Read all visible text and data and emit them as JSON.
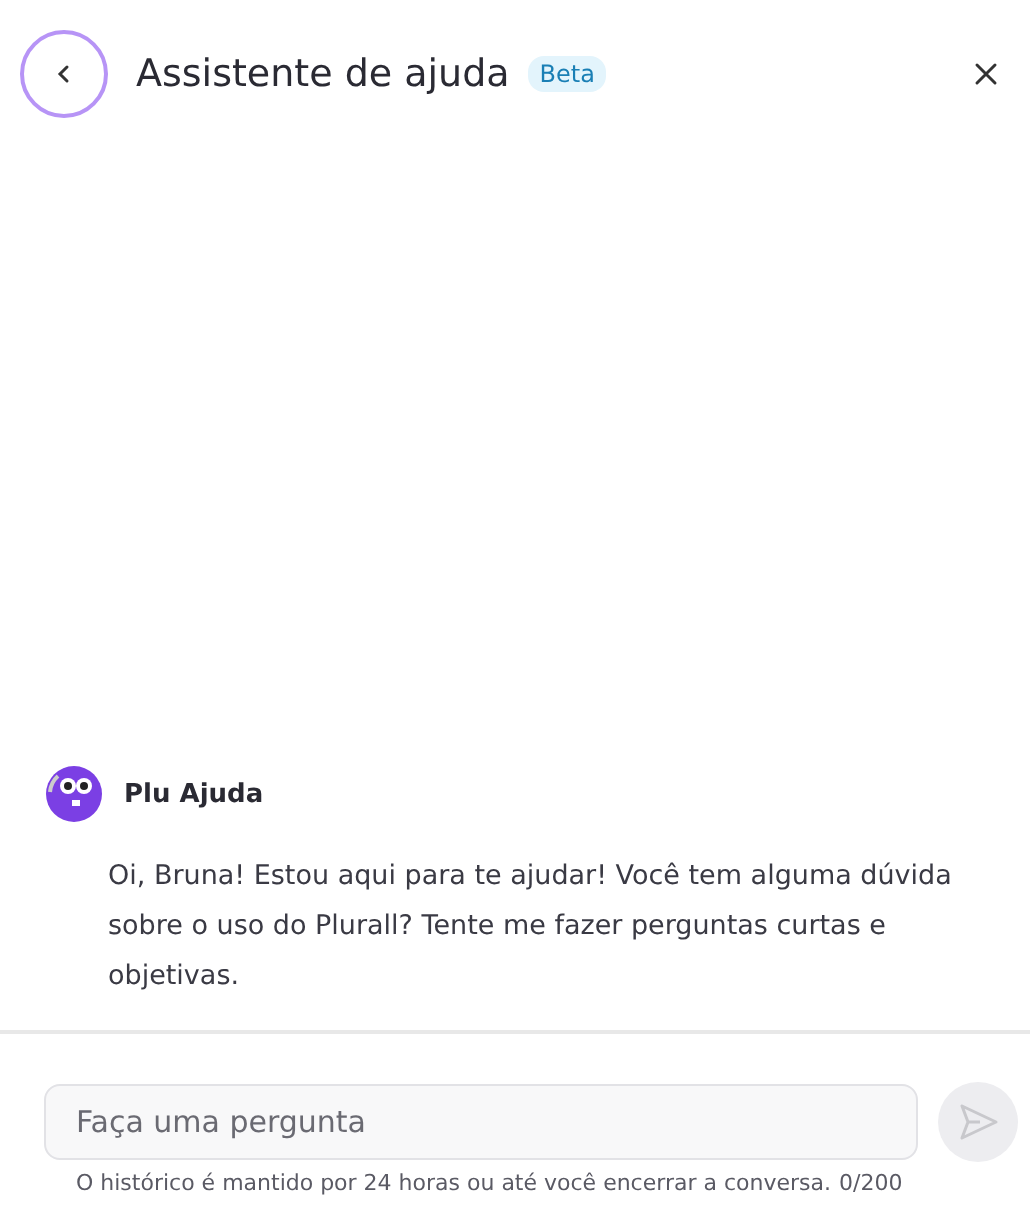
{
  "header": {
    "title": "Assistente de ajuda",
    "badge": "Beta"
  },
  "messages": [
    {
      "sender": "Plu Ajuda",
      "text": "Oi, Bruna! Estou aqui para te ajudar! Você tem alguma dúvida sobre o uso do Plurall? Tente me fazer perguntas curtas e objetivas."
    }
  ],
  "composer": {
    "placeholder": "Faça uma pergunta",
    "hint": "O histórico é mantido por 24 horas ou até você encerrar a conversa.",
    "counter": "0/200",
    "send_disabled": true
  }
}
